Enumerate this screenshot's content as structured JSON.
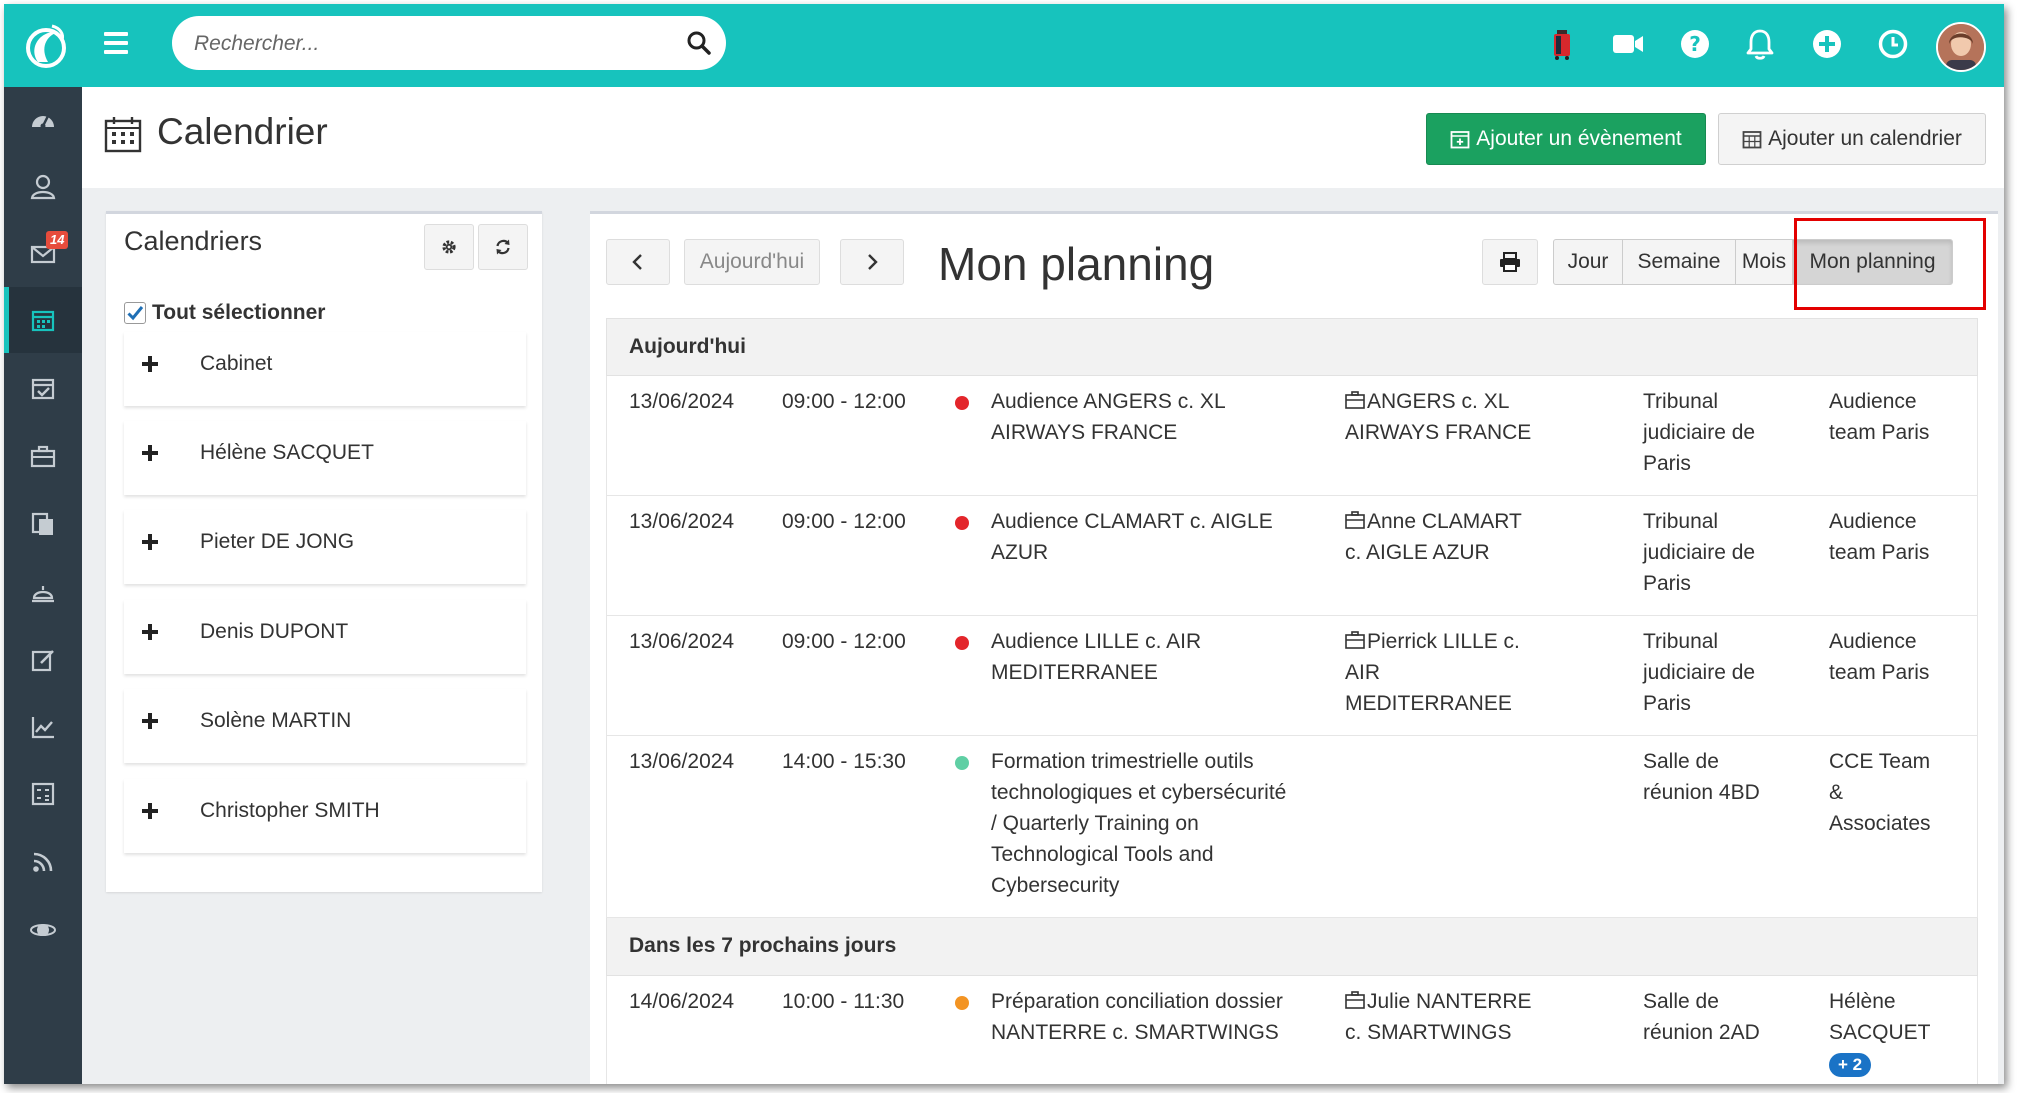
{
  "search": {
    "placeholder": "Rechercher..."
  },
  "sidebar": {
    "mail_badge": "14"
  },
  "page": {
    "title": "Calendrier"
  },
  "actions": {
    "add_event": "Ajouter un évènement",
    "add_calendar": "Ajouter un calendrier"
  },
  "calendars": {
    "title": "Calendriers",
    "select_all": "Tout sélectionner",
    "items": [
      {
        "label": "Cabinet"
      },
      {
        "label": "Hélène SACQUET"
      },
      {
        "label": "Pieter DE JONG"
      },
      {
        "label": "Denis DUPONT"
      },
      {
        "label": "Solène MARTIN"
      },
      {
        "label": "Christopher SMITH"
      }
    ]
  },
  "toolbar": {
    "today": "Aujourd'hui",
    "title": "Mon planning",
    "views": [
      "Jour",
      "Semaine",
      "Mois",
      "Mon planning"
    ]
  },
  "colors": {
    "accent": "#17c3bd",
    "red": "#e3262b",
    "teal": "#5fcfa4",
    "orange": "#f39423",
    "sidebar": "#2f3d48"
  },
  "sections": [
    {
      "title": "Aujourd'hui",
      "events": [
        {
          "date": "13/06/2024",
          "time": "09:00 - 12:00",
          "color": "#e3262b",
          "title": [
            "Audience ANGERS c. XL",
            "AIRWAYS FRANCE"
          ],
          "case": [
            "ANGERS c. XL",
            "AIRWAYS FRANCE"
          ],
          "location": [
            "Tribunal",
            "judiciaire de",
            "Paris"
          ],
          "who": [
            "Audience",
            "team Paris"
          ]
        },
        {
          "date": "13/06/2024",
          "time": "09:00 - 12:00",
          "color": "#e3262b",
          "title": [
            "Audience CLAMART c. AIGLE",
            "AZUR"
          ],
          "case": [
            "Anne CLAMART",
            "c. AIGLE AZUR"
          ],
          "location": [
            "Tribunal",
            "judiciaire de",
            "Paris"
          ],
          "who": [
            "Audience",
            "team Paris"
          ]
        },
        {
          "date": "13/06/2024",
          "time": "09:00 - 12:00",
          "color": "#e3262b",
          "title": [
            "Audience LILLE c. AIR",
            "MEDITERRANEE"
          ],
          "case": [
            "Pierrick LILLE c.",
            "AIR",
            "MEDITERRANEE"
          ],
          "location": [
            "Tribunal",
            "judiciaire de",
            "Paris"
          ],
          "who": [
            "Audience",
            "team Paris"
          ]
        },
        {
          "date": "13/06/2024",
          "time": "14:00 - 15:30",
          "color": "#5fcfa4",
          "title": [
            "Formation trimestrielle outils",
            "technologiques et cybersécurité",
            "/ Quarterly Training on",
            "Technological Tools and",
            "Cybersecurity"
          ],
          "case": [],
          "location": [
            "Salle de",
            "réunion 4BD"
          ],
          "who": [
            "CCE Team",
            "&",
            "Associates"
          ]
        }
      ]
    },
    {
      "title": "Dans les 7 prochains jours",
      "events": [
        {
          "date": "14/06/2024",
          "time": "10:00 - 11:30",
          "color": "#f39423",
          "title": [
            "Préparation conciliation dossier",
            "NANTERRE c. SMARTWINGS"
          ],
          "case": [
            "Julie NANTERRE",
            "c. SMARTWINGS"
          ],
          "location": [
            "Salle de",
            "réunion 2AD"
          ],
          "who": [
            "Hélène",
            "SACQUET"
          ],
          "extra": "+ 2"
        }
      ]
    }
  ]
}
